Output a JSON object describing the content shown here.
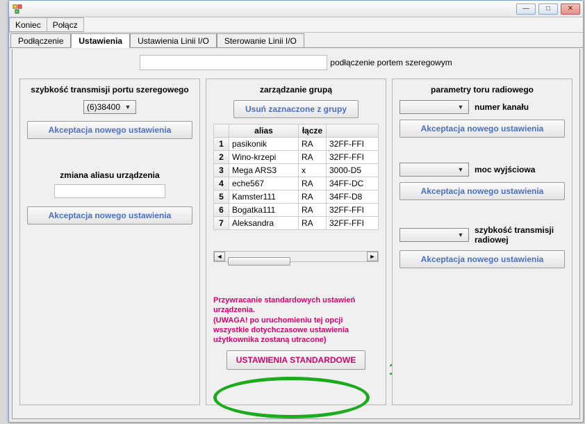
{
  "menu": {
    "koniec": "Koniec",
    "polacz": "Połącz"
  },
  "tabs": {
    "podlaczenie": "Podłączenie",
    "ustawienia": "Ustawienia",
    "ustawienia_linii_io": "Ustawienia Linii I/O",
    "sterowanie_linii_io": "Sterowanie Linii I/O"
  },
  "header": {
    "input_value": "",
    "label": "podłączenie portem szeregowym"
  },
  "col1": {
    "title": "szybkość transmisji portu szeregowego",
    "baud_selected": "(6)38400",
    "accept_label": "Akceptacja nowego ustawienia",
    "alias_title": "zmiana aliasu urządzenia",
    "alias_value": "",
    "accept_label2": "Akceptacja nowego ustawienia"
  },
  "col2": {
    "title": "zarządzanie grupą",
    "remove_label": "Usuń zaznaczone z grupy",
    "headers": {
      "alias": "alias",
      "lacze": "łącze",
      "extra": ""
    },
    "rows": [
      {
        "n": "1",
        "alias": "pasikonik",
        "lacze": "RA",
        "extra": "32FF-FFI"
      },
      {
        "n": "2",
        "alias": "Wino-krzepi",
        "lacze": "RA",
        "extra": "32FF-FFI"
      },
      {
        "n": "3",
        "alias": "Mega ARS3",
        "lacze": "x",
        "extra": "3000-D5"
      },
      {
        "n": "4",
        "alias": "eche567",
        "lacze": "RA",
        "extra": "34FF-DC"
      },
      {
        "n": "5",
        "alias": "Kamster111",
        "lacze": "RA",
        "extra": "34FF-D8"
      },
      {
        "n": "6",
        "alias": "Bogatka111",
        "lacze": "RA",
        "extra": "32FF-FFI"
      },
      {
        "n": "7",
        "alias": "Aleksandra",
        "lacze": "RA",
        "extra": "32FF-FFI"
      }
    ],
    "warning_l1": "Przywracanie standardowych ustawień urządzenia.",
    "warning_l2": "(UWAGA! po uruchomieniu tej opcji wszystkie dotychczasowe ustawienia użytkownika zostaną utracone)",
    "std_button": "USTAWIENIA STANDARDOWE"
  },
  "col3": {
    "title": "parametry toru radiowego",
    "channel_label": "numer kanału",
    "accept_label": "Akceptacja nowego ustawienia",
    "power_label": "moc wyjściowa",
    "accept_label2": "Akceptacja nowego ustawienia",
    "radiospeed_label": "szybkość transmisji radiowej",
    "accept_label3": "Akceptacja nowego ustawienia"
  },
  "annotation": {
    "number": "1"
  }
}
